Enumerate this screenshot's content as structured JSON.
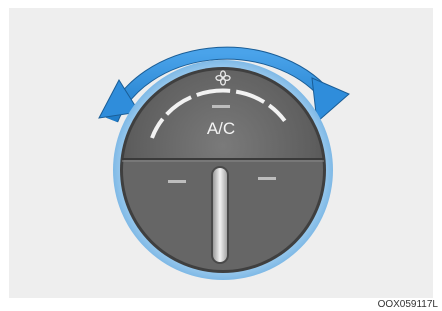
{
  "illustration": {
    "control": {
      "ac_label": "A/C",
      "fan_icon": "fan-icon",
      "rotation_arrow_color": "#2f8ddb",
      "knob_ring_color": "#8fc5ec",
      "knob_color": "#6b6b6b"
    },
    "figure_code": "OOX059117L"
  }
}
